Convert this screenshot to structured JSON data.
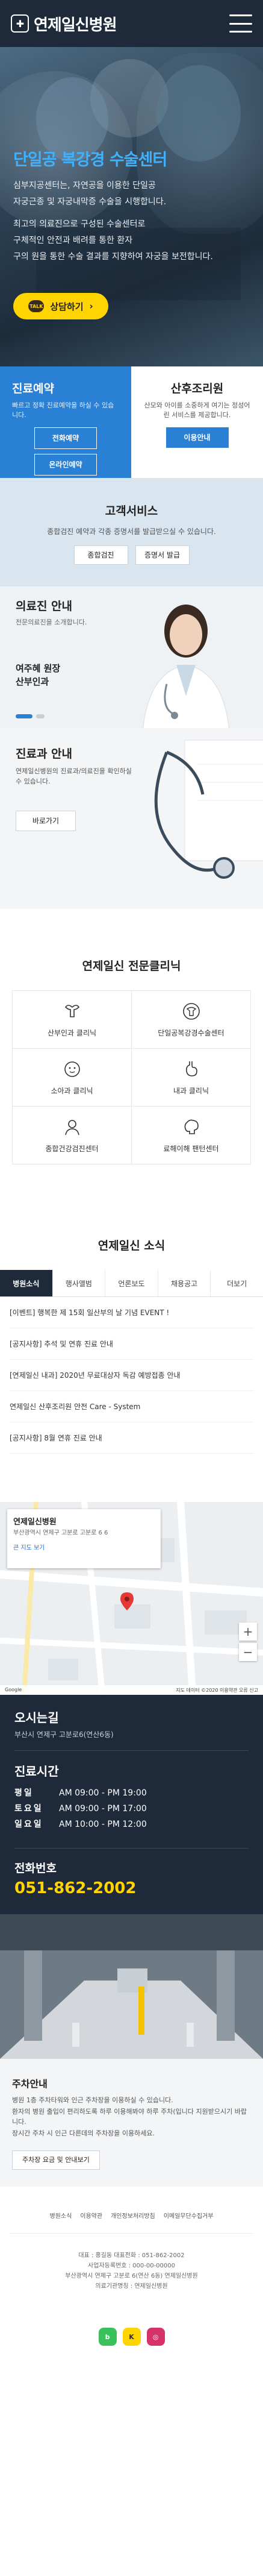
{
  "header": {
    "logo_text": "연제일신병원",
    "logo_mark": "✚"
  },
  "hero": {
    "title": "단일공 복강경 수술센터",
    "lines": [
      "심부지공센터는, 자연공을 이용한 단일공",
      "자궁근종 및 자궁내막증 수술을 시행합니다.",
      "",
      "최고의 의료진으로 구성된 수술센터로",
      "구체적인 안전과 배려를 통한 환자",
      "구의 원을 통한 수술 결과를 지향하여 자궁을 보전합니다."
    ],
    "cta_label": "상담하기",
    "cta_chat": "TALK"
  },
  "reservation": {
    "title": "진료예약",
    "text": "빠르고 정확 진료예약을 하실 수 있습니다.",
    "btn_phone": "전화예약",
    "btn_online": "온라인예약"
  },
  "postnatal": {
    "title": "산후조리원",
    "text": "산모와 아이를 소중하게 여기는 정성어린 서비스를 제공합니다.",
    "btn": "이용안내"
  },
  "service": {
    "title": "고객서비스",
    "text": "종합검진 예약과 각종 증명서를 발급받으실 수 있습니다.",
    "btn1": "종합검진",
    "btn2": "증명서 발급"
  },
  "doctors": {
    "title": "의료진 안내",
    "sub": "전문의료진을 소개합니다.",
    "name": "여주혜 원장",
    "dept": "산부인과"
  },
  "directions": {
    "title": "진료과 안내",
    "text": "연제일신병원의 진료과/의료진을 확인하실 수 있습니다.",
    "btn": "바로가기"
  },
  "clinics": {
    "title": "연제일신 전문클리닉",
    "items": [
      {
        "label": "산부인과 클리닉",
        "icon": "uterus-icon"
      },
      {
        "label": "단일공복강경수술센터",
        "icon": "uterus-center-icon"
      },
      {
        "label": "소아과 클리닉",
        "icon": "baby-face-icon"
      },
      {
        "label": "내과 클리닉",
        "icon": "stomach-icon"
      },
      {
        "label": "종합건강검진센터",
        "icon": "health-check-icon"
      },
      {
        "label": "료해이해 팬턴센터",
        "icon": "brain-icon"
      }
    ]
  },
  "news": {
    "title": "연제일신 소식",
    "tabs": [
      "병원소식",
      "행사앨범",
      "언론보도",
      "채용공고",
      "더보기"
    ],
    "items": [
      "[이벤트] 행복한 제 15회 일산부의 날 기념 EVENT !",
      "[공지사항] 추석 및 연휴 진료 안내",
      "[연제일신 내과] 2020년 무료대상자 독감 예방접종 안내",
      "연제일신 산후조리원 안전 Care - System",
      "[공지사항] 8월 연휴 진료 안내"
    ]
  },
  "map": {
    "card_name": "연제일신병원",
    "card_addr": "부산광역시 연제구 고분로 고분로 6 6",
    "card_link": "큰 지도 보기",
    "footer_left": "Google",
    "footer_right": "지도 데이터 ©2020  이용약관  오류 신고"
  },
  "hours": {
    "addr_title": "오시는길",
    "addr": "부산시 연제구 고분로6(연산6동)",
    "title": "진료시간",
    "rows": [
      {
        "day": "평일",
        "time": "AM 09:00 - PM 19:00"
      },
      {
        "day": "토요일",
        "time": "AM 09:00 - PM 17:00"
      },
      {
        "day": "일요일",
        "time": "AM 10:00 - PM 12:00"
      }
    ],
    "phone_title": "전화번호",
    "phone": "051-862-2002"
  },
  "parking": {
    "title": "주차안내",
    "lines": [
      "병원 1층 주차타워와 인근 주차장을 이용하실 수 있습니다.",
      "환자의 병원 출입이 편리하도록 하루 이용해봐야 하루 주차(입니다 지원받으시기 바랍니다.",
      "장시간 주차 시 인근 다른데의 주차장을 이용하세요."
    ],
    "btn": "주차장 요금 및 안내보기"
  },
  "footer": {
    "links": [
      "병원소식",
      "이용약관",
      "개인정보처리방침",
      "이메일무단수집거부"
    ],
    "lines": [
      "대표 : 홍길동  대표전화 : 051-862-2002",
      "사업자등록번호 : 000-00-00000",
      "부산광역시 연제구 고분로 6(연산 6동) 연제일신병원",
      "의료기관명칭 : 연제일신병원"
    ],
    "sns": [
      "blog",
      "kakao",
      "insta"
    ]
  },
  "colors": {
    "navy": "#1e2a3a",
    "blue": "#2a80d4",
    "yellow": "#ffd400",
    "light_blue_bg": "#d9e5ef"
  }
}
